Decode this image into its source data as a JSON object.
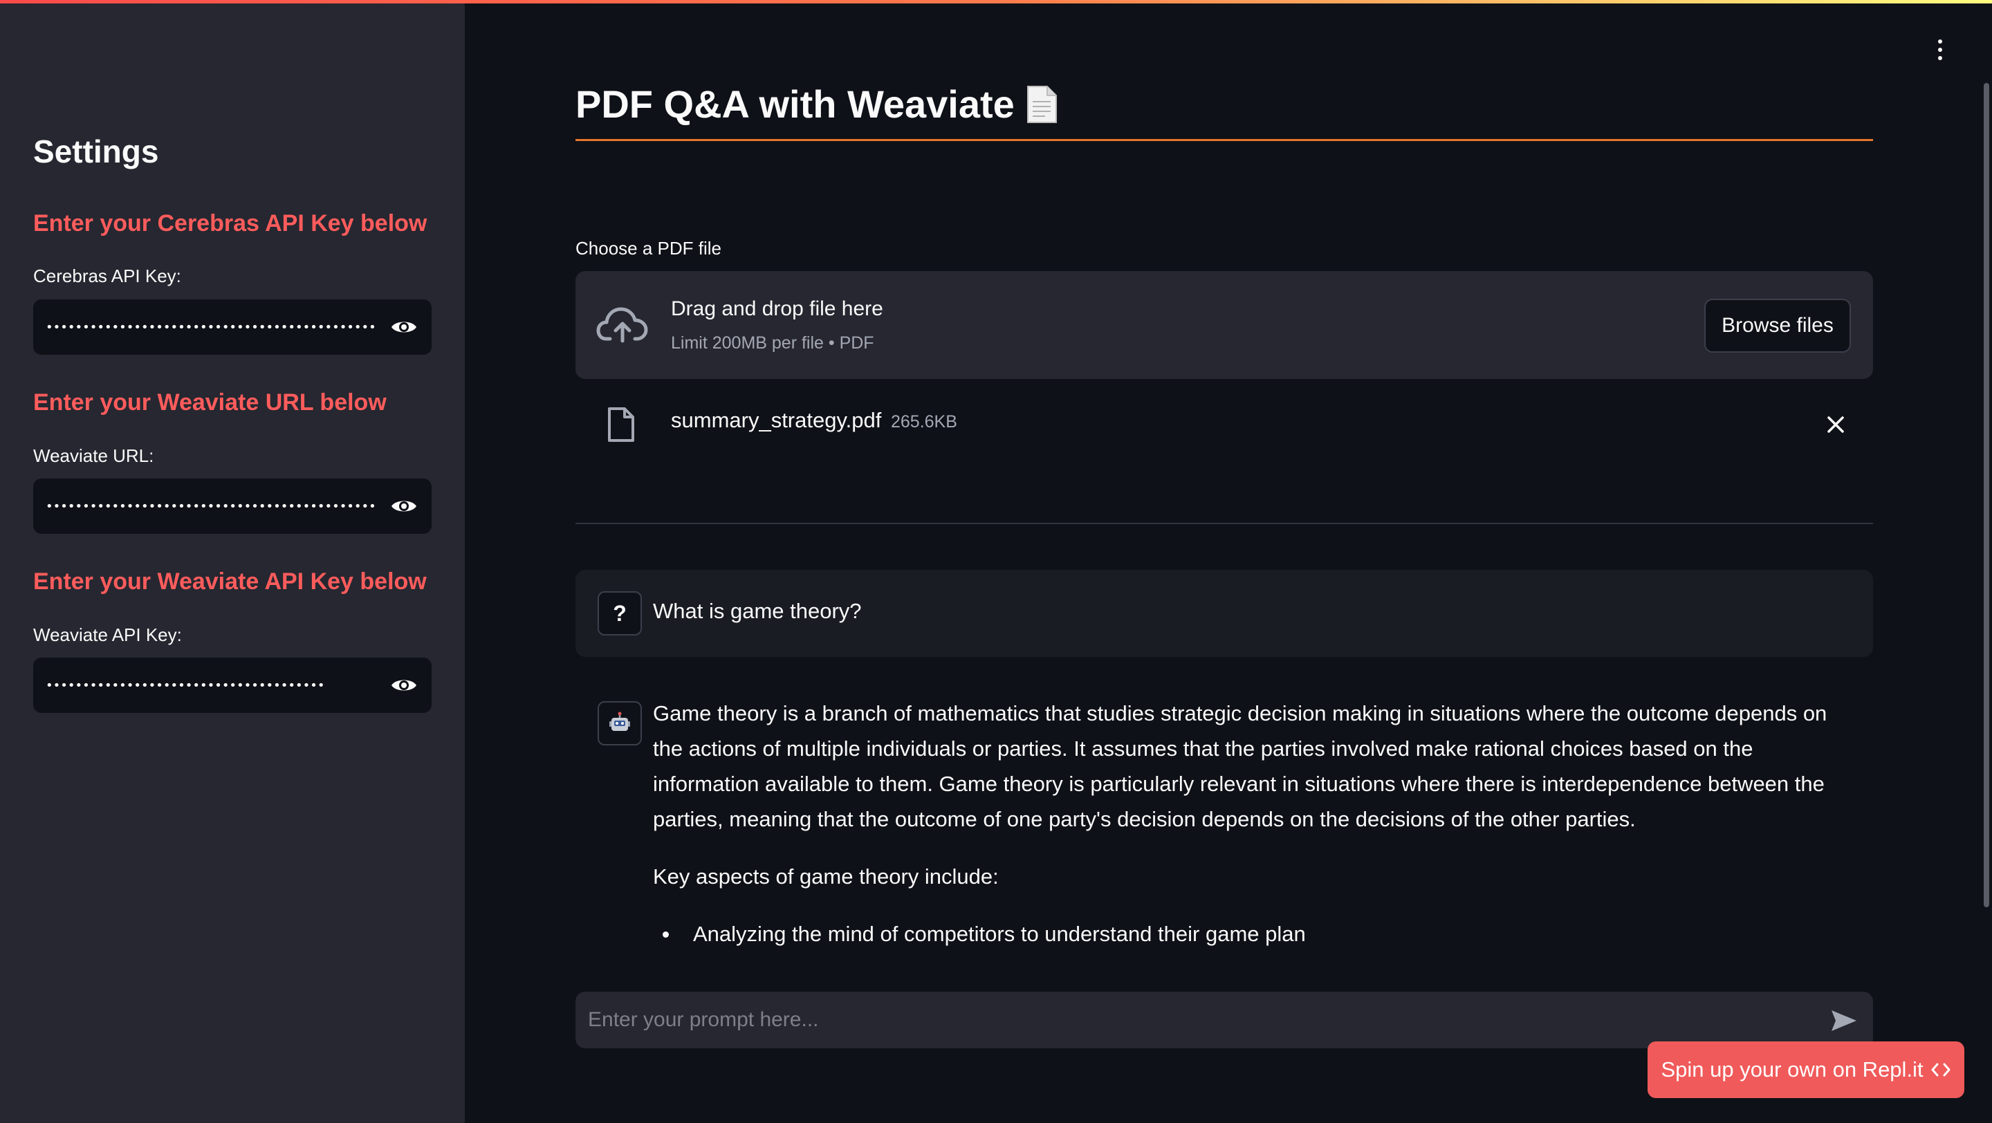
{
  "sidebar": {
    "title": "Settings",
    "sections": [
      {
        "heading": "Enter your Cerebras API Key below",
        "label": "Cerebras API Key:",
        "masked_value": "••••••••••••••••••••••••••••••••••••••••••••••••"
      },
      {
        "heading": "Enter your Weaviate URL below",
        "label": "Weaviate URL:",
        "masked_value": "••••••••••••••••••••••••••••••••••••••••••••••••"
      },
      {
        "heading": "Enter your Weaviate API Key below",
        "label": "Weaviate API Key:",
        "masked_value": "••••••••••••••••••••••••••••••••••••••"
      }
    ]
  },
  "header": {
    "title": "PDF Q&A with Weaviate",
    "title_icon": "page-document-icon"
  },
  "uploader": {
    "label": "Choose a PDF file",
    "drop_text": "Drag and drop file here",
    "limit_text": "Limit 200MB per file • PDF",
    "browse_label": "Browse files",
    "file": {
      "name": "summary_strategy.pdf",
      "size": "265.6KB"
    }
  },
  "chat": {
    "user_avatar": "?",
    "user_message": "What is game theory?",
    "assistant_avatar": "robot-icon",
    "assistant_paragraphs": [
      "Game theory is a branch of mathematics that studies strategic decision making in situations where the outcome depends on the actions of multiple individuals or parties. It assumes that the parties involved make rational choices based on the information available to them. Game theory is particularly relevant in situations where there is interdependence between the parties, meaning that the outcome of one party's decision depends on the decisions of the other parties.",
      "Key aspects of game theory include:"
    ],
    "assistant_bullets": [
      "Analyzing the mind of competitors to understand their game plan"
    ],
    "input_placeholder": "Enter your prompt here..."
  },
  "footer": {
    "repl_label": "Spin up your own on Repl.it"
  },
  "colors": {
    "accent_red": "#ff5c5c",
    "title_rule": "#e8752e",
    "repl_button": "#f05a5a",
    "sidebar_bg": "#262730",
    "main_bg": "#0e1117"
  }
}
